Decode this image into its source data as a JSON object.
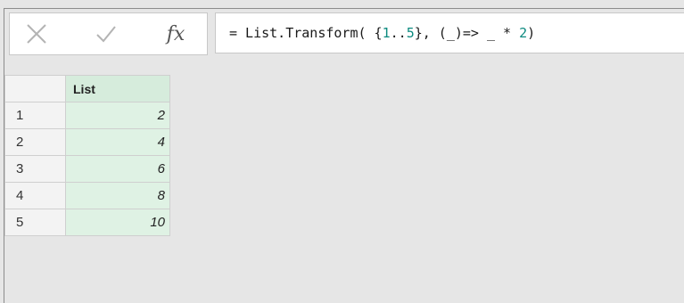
{
  "formula_bar": {
    "cancel_icon": "close-x-icon",
    "commit_icon": "checkmark-icon",
    "fx_label": "fx",
    "formula_prefix": "= List.Transform( {",
    "range_start": "1",
    "range_sep": "..",
    "range_end": "5",
    "formula_middle": "}, (_)=> _ * ",
    "multiplier": "2",
    "formula_suffix": ")"
  },
  "grid": {
    "column_header": "List",
    "rows": [
      {
        "index": "1",
        "value": "2"
      },
      {
        "index": "2",
        "value": "4"
      },
      {
        "index": "3",
        "value": "6"
      },
      {
        "index": "4",
        "value": "8"
      },
      {
        "index": "5",
        "value": "10"
      }
    ]
  },
  "colors": {
    "header_bg": "#d6ecdc",
    "cell_bg": "#dff2e4",
    "number_literal": "#0b8a7f",
    "workspace_bg": "#e6e6e6"
  }
}
